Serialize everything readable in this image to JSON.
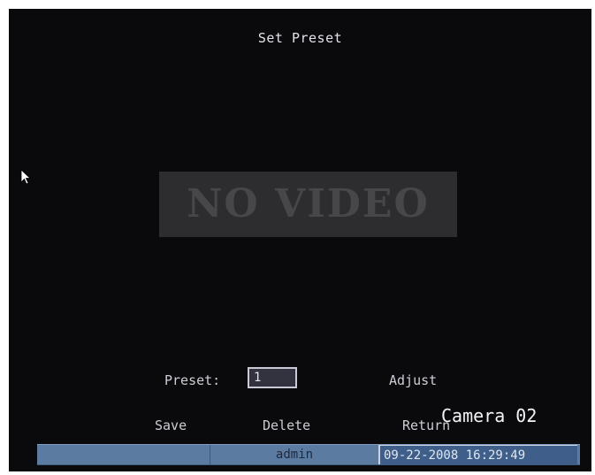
{
  "screen": {
    "title": "Set Preset",
    "no_video_text": "NO VIDEO",
    "camera_label": "Camera 02"
  },
  "form": {
    "preset_label": "Preset:",
    "preset_value": "1",
    "adjust_label": "Adjust"
  },
  "actions": {
    "save_label": "Save",
    "delete_label": "Delete",
    "return_label": "Return"
  },
  "status_bar": {
    "left_text": "",
    "user": "admin",
    "datetime": "09-22-2008 16:29:49"
  },
  "icons": {
    "cursor": "mouse-pointer-icon"
  },
  "colors": {
    "screen_background": "#0a0a0c",
    "status_bar": "#5c7ba0",
    "no_video_box": "#2d2d2f"
  }
}
